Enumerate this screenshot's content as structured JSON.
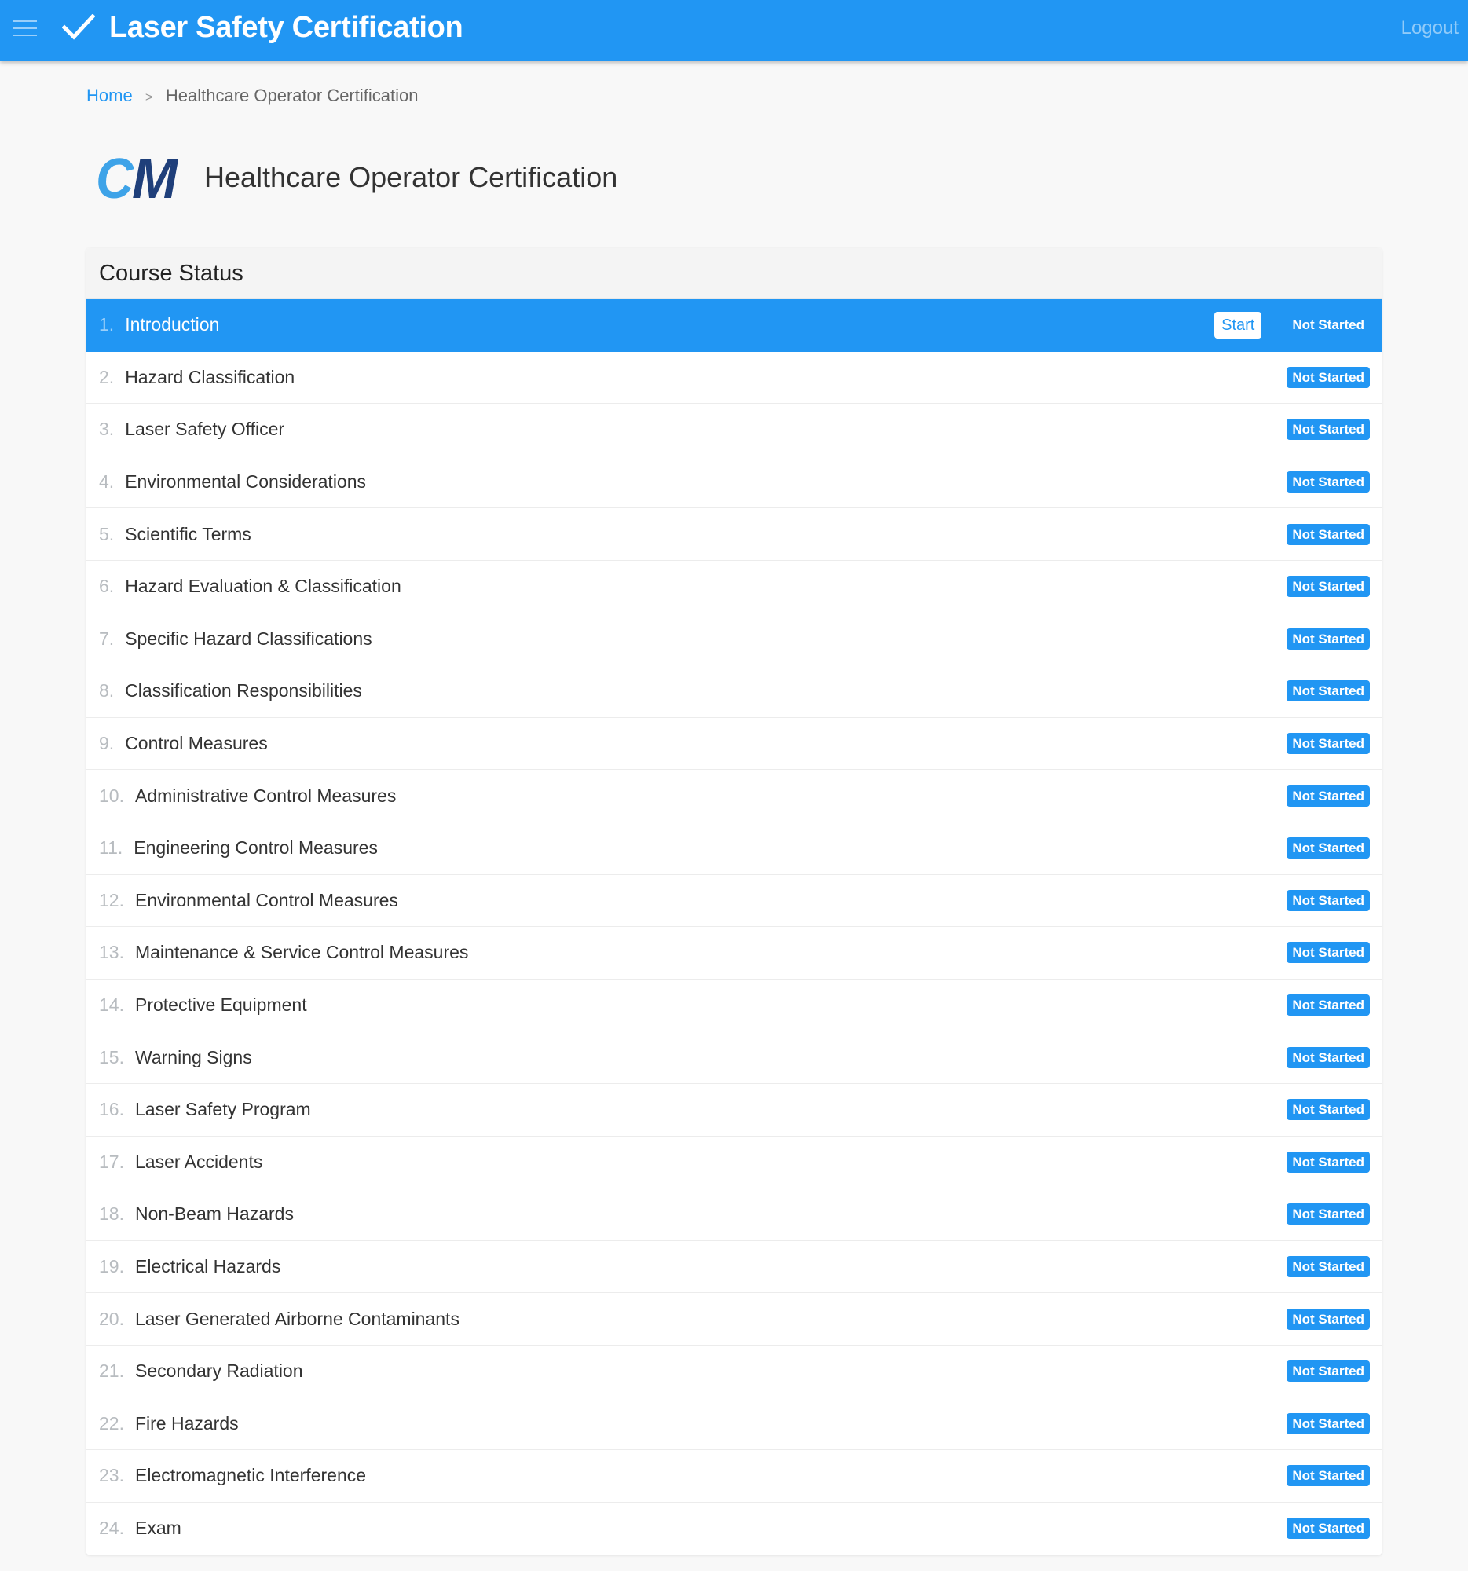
{
  "app": {
    "title": "Laser Safety Certification",
    "menu_icon": "hamburger-menu-icon",
    "brand_icon": "checkmark-icon",
    "logout_label": "Logout",
    "colors": {
      "primary": "#2196f3",
      "logo_light": "#3ea3e8",
      "logo_dark": "#1f3f7a"
    }
  },
  "breadcrumb": {
    "home": "Home",
    "separator": ">",
    "current": "Healthcare Operator Certification"
  },
  "page": {
    "logo_text": "CM",
    "title": "Healthcare Operator Certification"
  },
  "course_status": {
    "heading": "Course Status",
    "start_label": "Start",
    "items": [
      {
        "num": "1.",
        "label": "Introduction",
        "status": "Not Started",
        "active": true
      },
      {
        "num": "2.",
        "label": "Hazard Classification",
        "status": "Not Started"
      },
      {
        "num": "3.",
        "label": "Laser Safety Officer",
        "status": "Not Started"
      },
      {
        "num": "4.",
        "label": "Environmental Considerations",
        "status": "Not Started"
      },
      {
        "num": "5.",
        "label": "Scientific Terms",
        "status": "Not Started"
      },
      {
        "num": "6.",
        "label": "Hazard Evaluation & Classification",
        "status": "Not Started"
      },
      {
        "num": "7.",
        "label": "Specific Hazard Classifications",
        "status": "Not Started"
      },
      {
        "num": "8.",
        "label": "Classification Responsibilities",
        "status": "Not Started"
      },
      {
        "num": "9.",
        "label": "Control Measures",
        "status": "Not Started"
      },
      {
        "num": "10.",
        "label": "Administrative Control Measures",
        "status": "Not Started"
      },
      {
        "num": "11.",
        "label": "Engineering Control Measures",
        "status": "Not Started"
      },
      {
        "num": "12.",
        "label": "Environmental Control Measures",
        "status": "Not Started"
      },
      {
        "num": "13.",
        "label": "Maintenance & Service Control Measures",
        "status": "Not Started"
      },
      {
        "num": "14.",
        "label": "Protective Equipment",
        "status": "Not Started"
      },
      {
        "num": "15.",
        "label": "Warning Signs",
        "status": "Not Started"
      },
      {
        "num": "16.",
        "label": "Laser Safety Program",
        "status": "Not Started"
      },
      {
        "num": "17.",
        "label": "Laser Accidents",
        "status": "Not Started"
      },
      {
        "num": "18.",
        "label": "Non-Beam Hazards",
        "status": "Not Started"
      },
      {
        "num": "19.",
        "label": "Electrical Hazards",
        "status": "Not Started"
      },
      {
        "num": "20.",
        "label": "Laser Generated Airborne Contaminants",
        "status": "Not Started"
      },
      {
        "num": "21.",
        "label": "Secondary Radiation",
        "status": "Not Started"
      },
      {
        "num": "22.",
        "label": "Fire Hazards",
        "status": "Not Started"
      },
      {
        "num": "23.",
        "label": "Electromagnetic Interference",
        "status": "Not Started"
      },
      {
        "num": "24.",
        "label": "Exam",
        "status": "Not Started"
      }
    ]
  }
}
